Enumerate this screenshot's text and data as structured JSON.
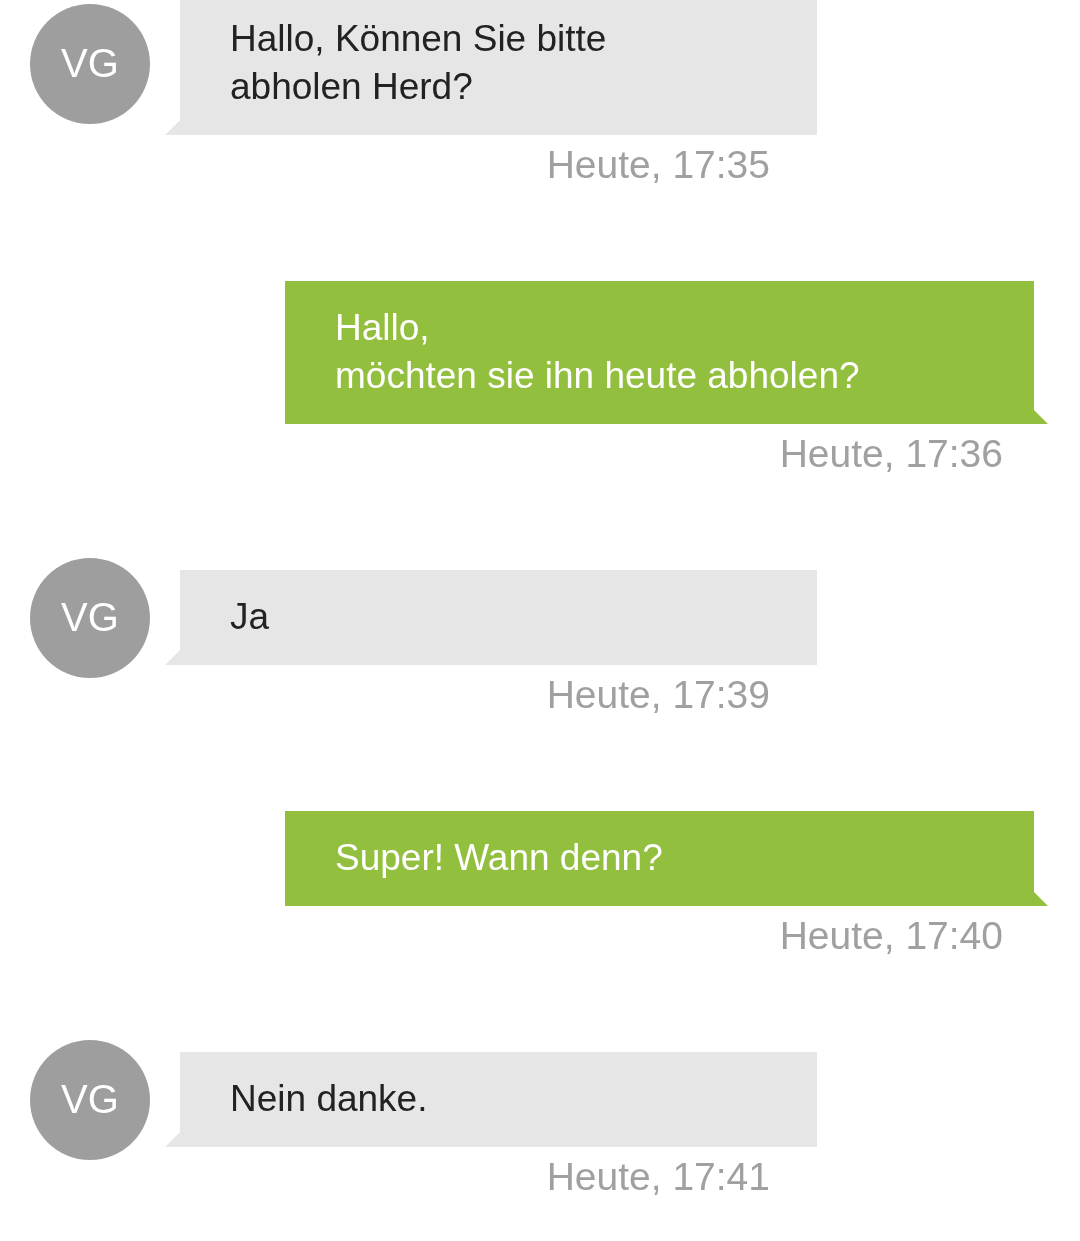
{
  "messages": [
    {
      "kind": "incoming",
      "avatar": "VG",
      "lines": [
        "Hallo, Können Sie bitte",
        "abholen Herd?"
      ],
      "time": "Heute, 17:35"
    },
    {
      "kind": "outgoing",
      "lines": [
        "Hallo,",
        "möchten sie ihn heute abholen?"
      ],
      "time": "Heute, 17:36"
    },
    {
      "kind": "incoming",
      "avatar": "VG",
      "lines": [
        "Ja"
      ],
      "time": "Heute, 17:39"
    },
    {
      "kind": "outgoing",
      "lines": [
        "Super! Wann denn?"
      ],
      "time": "Heute, 17:40"
    },
    {
      "kind": "incoming",
      "avatar": "VG",
      "lines": [
        "Nein danke."
      ],
      "time": "Heute, 17:41"
    }
  ]
}
